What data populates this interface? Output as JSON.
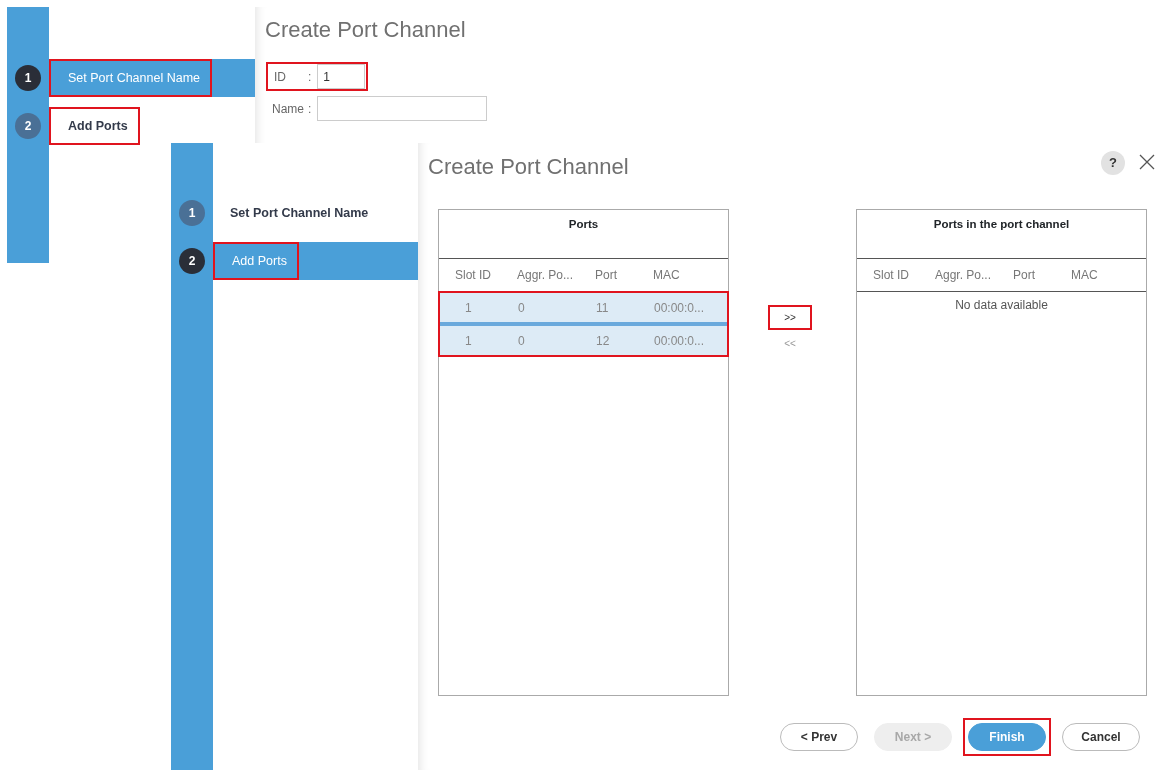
{
  "screenshots": [
    {
      "steps": [
        {
          "number": "1",
          "label": "Set Port Channel Name",
          "selected": true,
          "highlighted": true
        },
        {
          "number": "2",
          "label": "Add Ports",
          "selected": false,
          "highlighted": true
        }
      ],
      "title": "Create Port Channel",
      "fields": [
        {
          "label": "ID",
          "colon": ":",
          "value": "1",
          "highlighted": true
        },
        {
          "label": "Name",
          "colon": ":",
          "highlighted": false
        }
      ]
    },
    {
      "steps": [
        {
          "number": "1",
          "label": "Set Port Channel Name",
          "selected": false,
          "highlighted": false
        },
        {
          "number": "2",
          "label": "Add Ports",
          "selected": true,
          "highlighted": true
        }
      ],
      "title": "Create Port Channel",
      "help": "?",
      "tables": [
        {
          "title": "Ports",
          "columns": [
            "Slot ID",
            "Aggr. Po...",
            "Port",
            "MAC"
          ],
          "rows_highlighted": true,
          "rows": [
            {
              "cells": [
                "1",
                "0",
                "11",
                "00:00:0..."
              ],
              "selected": true
            },
            {
              "cells": [
                "1",
                "0",
                "12",
                "00:00:0..."
              ],
              "selected": true
            }
          ]
        },
        {
          "title": "Ports in the port channel",
          "columns": [
            "Slot ID",
            "Aggr. Po...",
            "Port",
            "MAC"
          ],
          "rows_highlighted": false,
          "empty_text": "No data available"
        }
      ],
      "move_buttons": [
        {
          "label": ">>",
          "disabled": false,
          "highlighted": true
        },
        {
          "label": "<<",
          "disabled": true,
          "highlighted": false
        }
      ],
      "buttons": [
        {
          "label": "< Prev",
          "kind": "default",
          "disabled": false,
          "highlighted": false
        },
        {
          "label": "Next >",
          "kind": "default",
          "disabled": true,
          "highlighted": false
        },
        {
          "label": "Finish",
          "kind": "primary",
          "disabled": false,
          "highlighted": true
        },
        {
          "label": "Cancel",
          "kind": "default",
          "disabled": false,
          "highlighted": false
        }
      ]
    }
  ]
}
